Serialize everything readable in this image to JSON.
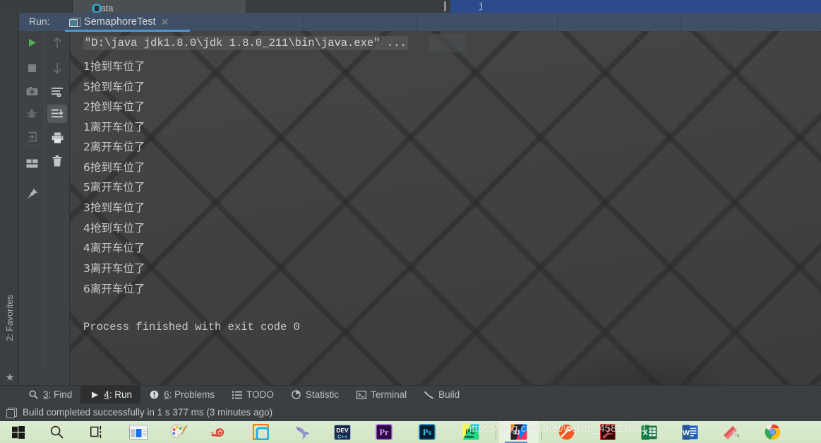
{
  "top_strip": {
    "partial_tab_label": "Data",
    "partial_tab_icon": "database-icon",
    "selection_glyph": "j"
  },
  "favorites_rail": {
    "label": "2: Favorites",
    "shortcut_digit": "2",
    "star_icon": "star-icon"
  },
  "run_window": {
    "run_label": "Run:",
    "tab_name": "SemaphoreTest",
    "tab_icon": "run-configuration-icon",
    "close_icon": "close-icon",
    "toolbar_left": [
      {
        "name": "rerun-button",
        "icon": "play-icon",
        "enabled": true,
        "selected": false
      },
      {
        "name": "stop-button",
        "icon": "stop-icon",
        "enabled": false,
        "selected": false
      },
      {
        "name": "screenshot-button",
        "icon": "camera-icon",
        "enabled": false,
        "selected": false
      },
      {
        "name": "debug-button",
        "icon": "bug-icon",
        "enabled": false,
        "selected": false
      },
      {
        "name": "attach-button",
        "icon": "import-icon",
        "enabled": false,
        "selected": false
      },
      {
        "name": "layout-button",
        "icon": "layout-icon",
        "enabled": true,
        "selected": false
      },
      {
        "name": "pin-tab-button",
        "icon": "pin-icon",
        "enabled": true,
        "selected": false
      }
    ],
    "toolbar_right": [
      {
        "name": "up-stack-button",
        "icon": "arrow-up-icon",
        "enabled": false,
        "selected": false
      },
      {
        "name": "down-stack-button",
        "icon": "arrow-down-icon",
        "enabled": false,
        "selected": false
      },
      {
        "name": "soft-wrap-button",
        "icon": "soft-wrap-icon",
        "enabled": true,
        "selected": false
      },
      {
        "name": "scroll-to-end-button",
        "icon": "scroll-end-icon",
        "enabled": true,
        "selected": true
      },
      {
        "name": "print-button",
        "icon": "printer-icon",
        "enabled": true,
        "selected": false
      },
      {
        "name": "clear-all-button",
        "icon": "trash-icon",
        "enabled": true,
        "selected": false
      }
    ],
    "console": {
      "command_line": "\"D:\\java jdk1.8.0\\jdk 1.8.0_211\\bin\\java.exe\" ...",
      "lines": [
        "1抢到车位了",
        "5抢到车位了",
        "2抢到车位了",
        "1离开车位了",
        "2离开车位了",
        "6抢到车位了",
        "5离开车位了",
        "3抢到车位了",
        "4抢到车位了",
        "4离开车位了",
        "3离开车位了",
        "6离开车位了",
        "",
        "Process finished with exit code 0"
      ]
    }
  },
  "tool_window_bar": [
    {
      "label": "3: Find",
      "shortcut": "3",
      "text": ": Find",
      "icon": "search-icon",
      "active": false
    },
    {
      "label": "4: Run",
      "shortcut": "4",
      "text": ": Run",
      "icon": "play-icon",
      "active": true
    },
    {
      "label": "6: Problems",
      "shortcut": "6",
      "text": ": Problems",
      "icon": "warning-icon",
      "active": false
    },
    {
      "label": "TODO",
      "shortcut": "",
      "text": "TODO",
      "icon": "list-icon",
      "active": false
    },
    {
      "label": "Statistic",
      "shortcut": "",
      "text": "Statistic",
      "icon": "pie-chart-icon",
      "active": false
    },
    {
      "label": "Terminal",
      "shortcut": "",
      "text": "Terminal",
      "icon": "terminal-icon",
      "active": false
    },
    {
      "label": "Build",
      "shortcut": "",
      "text": "Build",
      "icon": "hammer-icon",
      "active": false
    }
  ],
  "status_bar": {
    "icon": "build-icon",
    "message": "Build completed successfully in 1 s 377 ms (3 minutes ago)"
  },
  "taskbar": {
    "watermark": "https://blog.csdn.net/weixin_45827693",
    "items": [
      {
        "name": "start-button",
        "icon": "windows-logo-icon",
        "active": false
      },
      {
        "name": "search-button",
        "icon": "search-icon",
        "active": false
      },
      {
        "name": "task-view-button",
        "icon": "task-view-icon",
        "active": false
      },
      {
        "name": "news-app",
        "icon": "news-window-icon",
        "active": false
      },
      {
        "name": "paint-app",
        "icon": "paint-palette-icon",
        "active": false
      },
      {
        "name": "snipaste-app",
        "icon": "snail-icon",
        "active": false
      },
      {
        "name": "vmware-app",
        "icon": "vmware-icon",
        "active": false
      },
      {
        "name": "navicat-app",
        "icon": "dolphin-icon",
        "active": false
      },
      {
        "name": "devcpp-app",
        "icon": "dev-cpp-icon",
        "active": false
      },
      {
        "name": "premiere-app",
        "icon": "premiere-icon",
        "active": false
      },
      {
        "name": "photoshop-app",
        "icon": "photoshop-icon",
        "active": false
      },
      {
        "name": "pycharm-app",
        "icon": "pycharm-icon",
        "active": false
      },
      {
        "name": "intellij-idea-app",
        "icon": "intellij-idea-icon",
        "active": true
      },
      {
        "name": "tool-app",
        "icon": "orange-tool-icon",
        "active": false
      },
      {
        "name": "acrobat-app",
        "icon": "acrobat-icon",
        "active": false
      },
      {
        "name": "excel-app",
        "icon": "excel-icon",
        "active": false
      },
      {
        "name": "word-app",
        "icon": "word-icon",
        "active": false
      },
      {
        "name": "books-app",
        "icon": "books-icon",
        "active": false
      },
      {
        "name": "chrome-app",
        "icon": "chrome-icon",
        "active": false
      }
    ]
  }
}
